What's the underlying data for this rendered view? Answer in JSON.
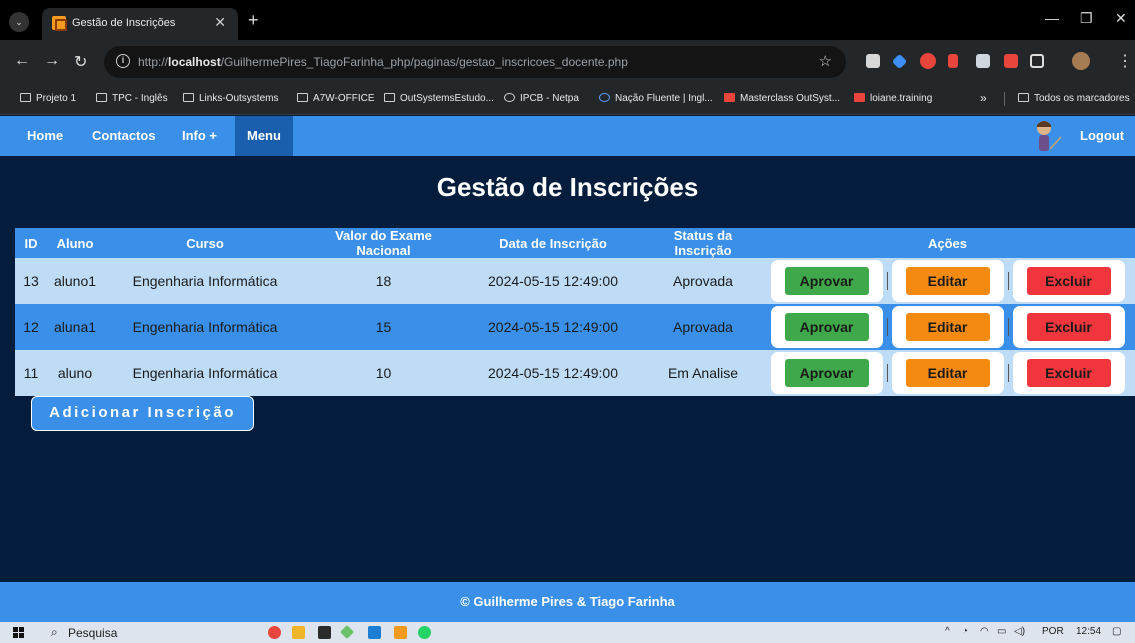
{
  "browser": {
    "tab_title": "Gestão de Inscrições",
    "url_prefix": "http://",
    "url_host": "localhost",
    "url_path": "/GuilhermePires_TiagoFarinha_php/paginas/gestao_inscricoes_docente.php",
    "bookmarks": [
      "Projeto 1",
      "TPC - Inglês",
      "Links-Outsystems",
      "A7W-OFFICE",
      "OutSystemsEstudo...",
      "IPCB - Netpa",
      "Nação Fluente | Ingl...",
      "Masterclass OutSyst...",
      "loiane.training"
    ],
    "all_bookmarks": "Todos os marcadores",
    "more": "»"
  },
  "nav": {
    "home": "Home",
    "contacts": "Contactos",
    "info": "Info +",
    "menu": "Menu",
    "logout": "Logout"
  },
  "page_title": "Gestão de Inscrições",
  "table": {
    "headers": [
      "ID",
      "Aluno",
      "Curso",
      "Valor do Exame Nacional",
      "Data de Inscrição",
      "Status da Inscrição",
      "Ações"
    ],
    "rows": [
      {
        "id": "13",
        "aluno": "aluno1",
        "curso": "Engenharia Informática",
        "valor": "18",
        "data": "2024-05-15 12:49:00",
        "status": "Aprovada"
      },
      {
        "id": "12",
        "aluno": "aluna1",
        "curso": "Engenharia Informática",
        "valor": "15",
        "data": "2024-05-15 12:49:00",
        "status": "Aprovada"
      },
      {
        "id": "11",
        "aluno": "aluno",
        "curso": "Engenharia Informática",
        "valor": "10",
        "data": "2024-05-15 12:49:00",
        "status": "Em Analise"
      }
    ],
    "approve_label": "Aprovar",
    "edit_label": "Editar",
    "delete_label": "Excluir"
  },
  "add_button": "Adicionar Inscrição",
  "footer": "© Guilherme Pires & Tiago Farinha",
  "taskbar": {
    "search": "Pesquisa",
    "lang": "POR",
    "time": "12:54"
  },
  "colors": {
    "page_bg": "#041d3d",
    "primary": "#3a8fe8",
    "row_light": "#bfdcf7",
    "approve": "#3fa84a",
    "edit": "#f58a10",
    "delete": "#f0353c"
  }
}
